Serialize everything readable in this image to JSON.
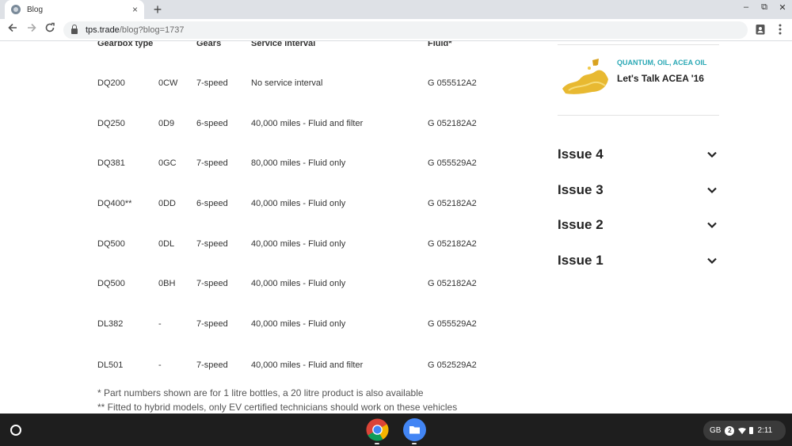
{
  "browser": {
    "tab_title": "Blog",
    "tab_close": "×",
    "new_tab": "+",
    "url_host": "tps.trade",
    "url_path": "/blog?blog=1737",
    "window_controls": [
      "–",
      "⧉",
      "✕"
    ]
  },
  "table": {
    "headers": {
      "gearbox_type": "Gearbox type",
      "gears": "Gears",
      "service_interval": "Service interval",
      "fluid": "Fluid*"
    },
    "rows": [
      {
        "model": "DQ200",
        "code": "0CW",
        "gears": "7-speed",
        "interval": "No service interval",
        "fluid": "G 055512A2"
      },
      {
        "model": "DQ250",
        "code": "0D9",
        "gears": "6-speed",
        "interval": "40,000 miles - Fluid and filter",
        "fluid": "G 052182A2"
      },
      {
        "model": "DQ381",
        "code": "0GC",
        "gears": "7-speed",
        "interval": "80,000 miles - Fluid only",
        "fluid": "G 055529A2"
      },
      {
        "model": "DQ400**",
        "code": "0DD",
        "gears": "6-speed",
        "interval": "40,000 miles - Fluid only",
        "fluid": "G 052182A2"
      },
      {
        "model": "DQ500",
        "code": "0DL",
        "gears": "7-speed",
        "interval": "40,000 miles - Fluid only",
        "fluid": "G 052182A2"
      },
      {
        "model": "DQ500",
        "code": "0BH",
        "gears": "7-speed",
        "interval": "40,000 miles - Fluid only",
        "fluid": "G 052182A2"
      },
      {
        "model": "DL382",
        "code": "-",
        "gears": "7-speed",
        "interval": "40,000 miles - Fluid only",
        "fluid": "G 055529A2"
      },
      {
        "model": "DL501",
        "code": "-",
        "gears": "7-speed",
        "interval": "40,000 miles - Fluid and filter",
        "fluid": "G 052529A2"
      }
    ]
  },
  "footnotes": [
    "* Part numbers shown are for 1 litre bottles, a 20 litre product is also available",
    "** Fitted to hybrid models, only EV certified technicians should work on these vehicles"
  ],
  "sidebar": {
    "post": {
      "tags": "QUANTUM, OIL, ACEA OIL",
      "title": "Let's Talk ACEA '16"
    },
    "issues": [
      "Issue 4",
      "Issue 3",
      "Issue 2",
      "Issue 1"
    ]
  },
  "shelf": {
    "tray_locale": "GB",
    "tray_notifications": "2",
    "tray_time": "2:11"
  },
  "colors": {
    "tag_accent": "#2aa8b5",
    "shelf_bg": "#1e1e1e"
  }
}
